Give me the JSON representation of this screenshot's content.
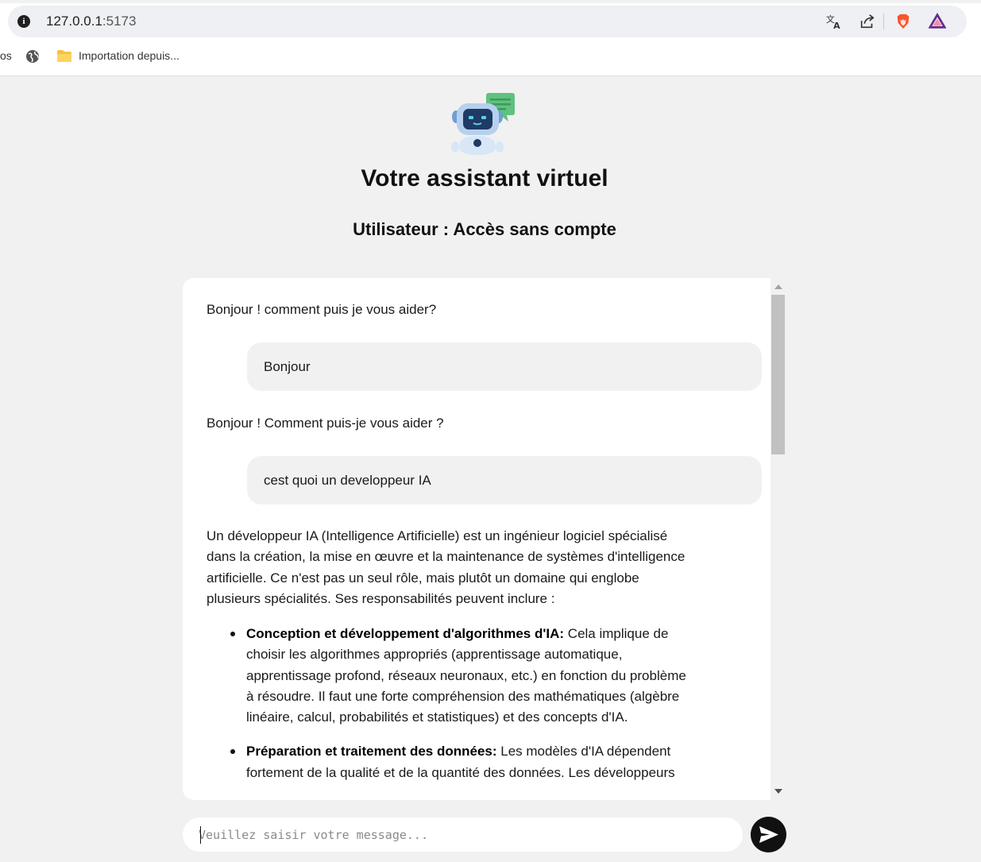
{
  "browser": {
    "url_host": "127.0.0.1",
    "url_port": ":5173",
    "bookmark_cut": "os",
    "bookmark_folder": "Importation depuis..."
  },
  "header": {
    "title": "Votre assistant virtuel",
    "subtitle": "Utilisateur : Accès sans compte"
  },
  "chat": {
    "messages": [
      {
        "role": "bot",
        "text": "Bonjour ! comment puis je vous aider?"
      },
      {
        "role": "user",
        "text": "Bonjour"
      },
      {
        "role": "bot",
        "text": "Bonjour ! Comment puis-je vous aider ?"
      },
      {
        "role": "user",
        "text": "cest quoi un developpeur IA"
      },
      {
        "role": "bot",
        "text": "Un développeur IA (Intelligence Artificielle) est un ingénieur logiciel spécialisé dans la création, la mise en œuvre et la maintenance de systèmes d'intelligence artificielle. Ce n'est pas un seul rôle, mais plutôt un domaine qui englobe plusieurs spécialités. Ses responsabilités peuvent inclure :"
      }
    ],
    "bullets": [
      {
        "title": "Conception et développement d'algorithmes d'IA:",
        "text": " Cela implique de choisir les algorithmes appropriés (apprentissage automatique, apprentissage profond, réseaux neuronaux, etc.) en fonction du problème à résoudre. Il faut une forte compréhension des mathématiques (algèbre linéaire, calcul, probabilités et statistiques) et des concepts d'IA."
      },
      {
        "title": "Préparation et traitement des données:",
        "text": " Les modèles d'IA dépendent fortement de la qualité et de la quantité des données. Les développeurs"
      }
    ]
  },
  "composer": {
    "placeholder": "Veuillez saisir votre message..."
  },
  "colors": {
    "page_bg": "#f1f1f1",
    "user_bubble": "#f1f1f1",
    "send_button": "#111111"
  },
  "icons": [
    "info-icon",
    "translate-icon",
    "share-icon",
    "brave-shield-icon",
    "brave-rewards-icon",
    "globe-icon",
    "folder-icon",
    "robot-chat-icon",
    "send-icon"
  ]
}
